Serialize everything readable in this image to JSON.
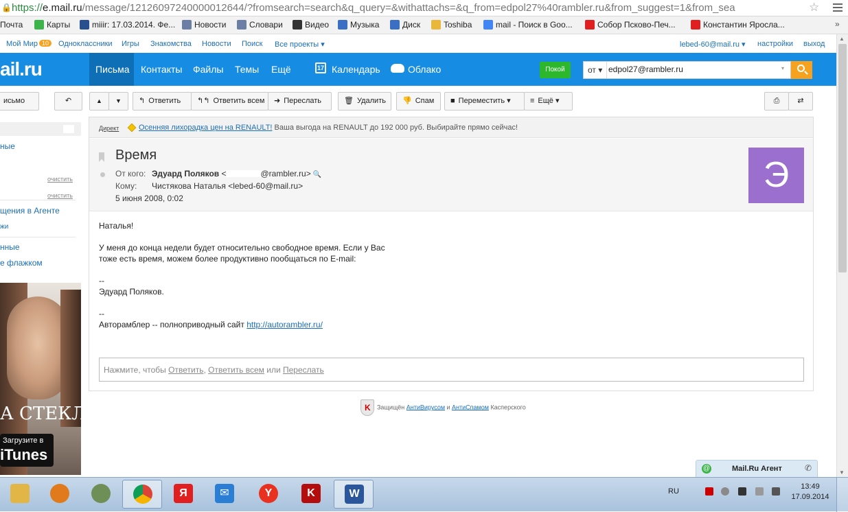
{
  "browser": {
    "url_scheme": "https://",
    "url_host": "e.mail.ru",
    "url_rest": "/message/12126097240000012644/?fromsearch=search&q_query=&withattachs=&q_from=edpol27%40rambler.ru&from_suggest=1&from_sea",
    "star_icon": "star-icon",
    "menu_icon": "menu-icon"
  },
  "bookmarks": [
    {
      "label": "Почта",
      "icon": "mail-icon",
      "color": "#f6a21e"
    },
    {
      "label": "Карты",
      "icon": "maps-icon",
      "color": "#3cb44a"
    },
    {
      "label": "miiir: 17.03.2014. Фе...",
      "icon": "user-icon",
      "color": "#2a4f8f"
    },
    {
      "label": "Новости",
      "icon": "news-icon",
      "color": "#6b7fa6"
    },
    {
      "label": "Словари",
      "icon": "dict-icon",
      "color": "#6b7fa6"
    },
    {
      "label": "Видео",
      "icon": "video-icon",
      "color": "#333333"
    },
    {
      "label": "Музыка",
      "icon": "music-icon",
      "color": "#3a6fc4"
    },
    {
      "label": "Диск",
      "icon": "disk-icon",
      "color": "#3a6fc4"
    },
    {
      "label": "Toshiba",
      "icon": "folder-icon",
      "color": "#e8b73c"
    },
    {
      "label": "mail - Поиск в Goo...",
      "icon": "google-icon",
      "color": "#4285f4"
    },
    {
      "label": "Собор Псково-Печ...",
      "icon": "yandex-icon",
      "color": "#e02020"
    },
    {
      "label": "Константин Яросла...",
      "icon": "yandex-icon",
      "color": "#e02020"
    }
  ],
  "bookmarks_more": "»",
  "toplinks": {
    "my_world": "Мой Мир",
    "my_world_badge": "10",
    "odnoklassniki": "Одноклассники",
    "games": "Игры",
    "dating": "Знакомства",
    "news": "Новости",
    "search": "Поиск",
    "all_projects": "Все проекты ▾",
    "account": "lebed-60@mail.ru ▾",
    "settings": "настройки",
    "logout": "выход"
  },
  "header": {
    "logo": "ail.ru",
    "nav": {
      "letters": "Письма",
      "contacts": "Контакты",
      "files": "Файлы",
      "themes": "Темы",
      "more": "Ещё",
      "calendar": "Календарь",
      "calendar_day": "17",
      "cloud": "Облако"
    },
    "calm_button": "Покой",
    "search": {
      "from_label": "от ▾",
      "value": "edpol27@rambler.ru",
      "caret": "▾"
    }
  },
  "toolbar": {
    "write": "исьмо",
    "undo_icon": "↶",
    "up_icon": "▲",
    "down_icon": "▼",
    "reply": "Ответить",
    "reply_all": "Ответить всем",
    "forward": "Переслать",
    "delete": "Удалить",
    "spam": "Спам",
    "move": "Переместить ▾",
    "more": "Ещё ▾"
  },
  "sidebar": {
    "item1": "ные",
    "clear1": "очистить",
    "clear2": "очистить",
    "agent_messages": "щения в Агенте",
    "small_link": "жи",
    "unread": "нные",
    "flagged": "е флажком",
    "ad": {
      "brand_text": "А СТЕКЛО",
      "download": "Загрузите в",
      "store": "iTunes"
    }
  },
  "message": {
    "direct": {
      "label": "Директ",
      "link": "Осенняя лихорадка цен на RENAULT!",
      "text": " Ваша выгода на RENAULT до 192 000 руб. Выбирайте прямо сейчас!"
    },
    "subject": "Время",
    "from_label": "От кого:",
    "from_name": "Эдуард Поляков",
    "from_email_tail": "@rambler.ru>",
    "from_email_head": " <",
    "to_label": "Кому:",
    "to_value": "Чистякова Наталья <lebed-60@mail.ru>",
    "date": "5 июня 2008, 0:02",
    "avatar_letter": "Э",
    "body": {
      "greeting": "Наталья!",
      "line1": "У меня до конца недели будет относительно свободное время. Если у Вас",
      "line2": "тоже есть время, можем более продуктивно пообщаться по E-mail:",
      "sep1": "--",
      "signature": "Эдуард Поляков.",
      "sep2": "--",
      "footer_text": "Авторамблер -- полноприводный сайт ",
      "footer_link": "http://autorambler.ru/"
    },
    "reply_box": {
      "prefix": "Нажмите, чтобы ",
      "reply": "Ответить",
      "comma": ", ",
      "reply_all": "Ответить всем",
      "or": " или ",
      "forward": "Переслать"
    }
  },
  "kaspersky": {
    "prefix": "Защищён ",
    "antivirus": "АнтиВирусом",
    "and": " и ",
    "antispam": "АнтиСпамом",
    "suffix": " Касперского"
  },
  "agent": {
    "title": "Mail.Ru Агент",
    "at": "@"
  },
  "taskbar": {
    "language": "RU",
    "time": "13:49",
    "date": "17.09.2014",
    "apps": [
      {
        "name": "explorer-icon",
        "color": "#e2b646",
        "label": ""
      },
      {
        "name": "media-player-icon",
        "color": "#e07a1a",
        "label": ""
      },
      {
        "name": "app-round-icon",
        "color": "#6e8f55",
        "label": ""
      },
      {
        "name": "chrome-icon",
        "color": "#3f8f3f",
        "label": ""
      },
      {
        "name": "yandex-icon",
        "color": "#e02020",
        "label": "Я"
      },
      {
        "name": "mail-agent-icon",
        "color": "#2a7fd4",
        "label": "✉"
      },
      {
        "name": "yandex-browser-icon",
        "color": "#e8321f",
        "label": "Y"
      },
      {
        "name": "kaspersky-icon",
        "color": "#b30d0d",
        "label": "K"
      },
      {
        "name": "word-icon",
        "color": "#2b579a",
        "label": "W"
      }
    ]
  }
}
